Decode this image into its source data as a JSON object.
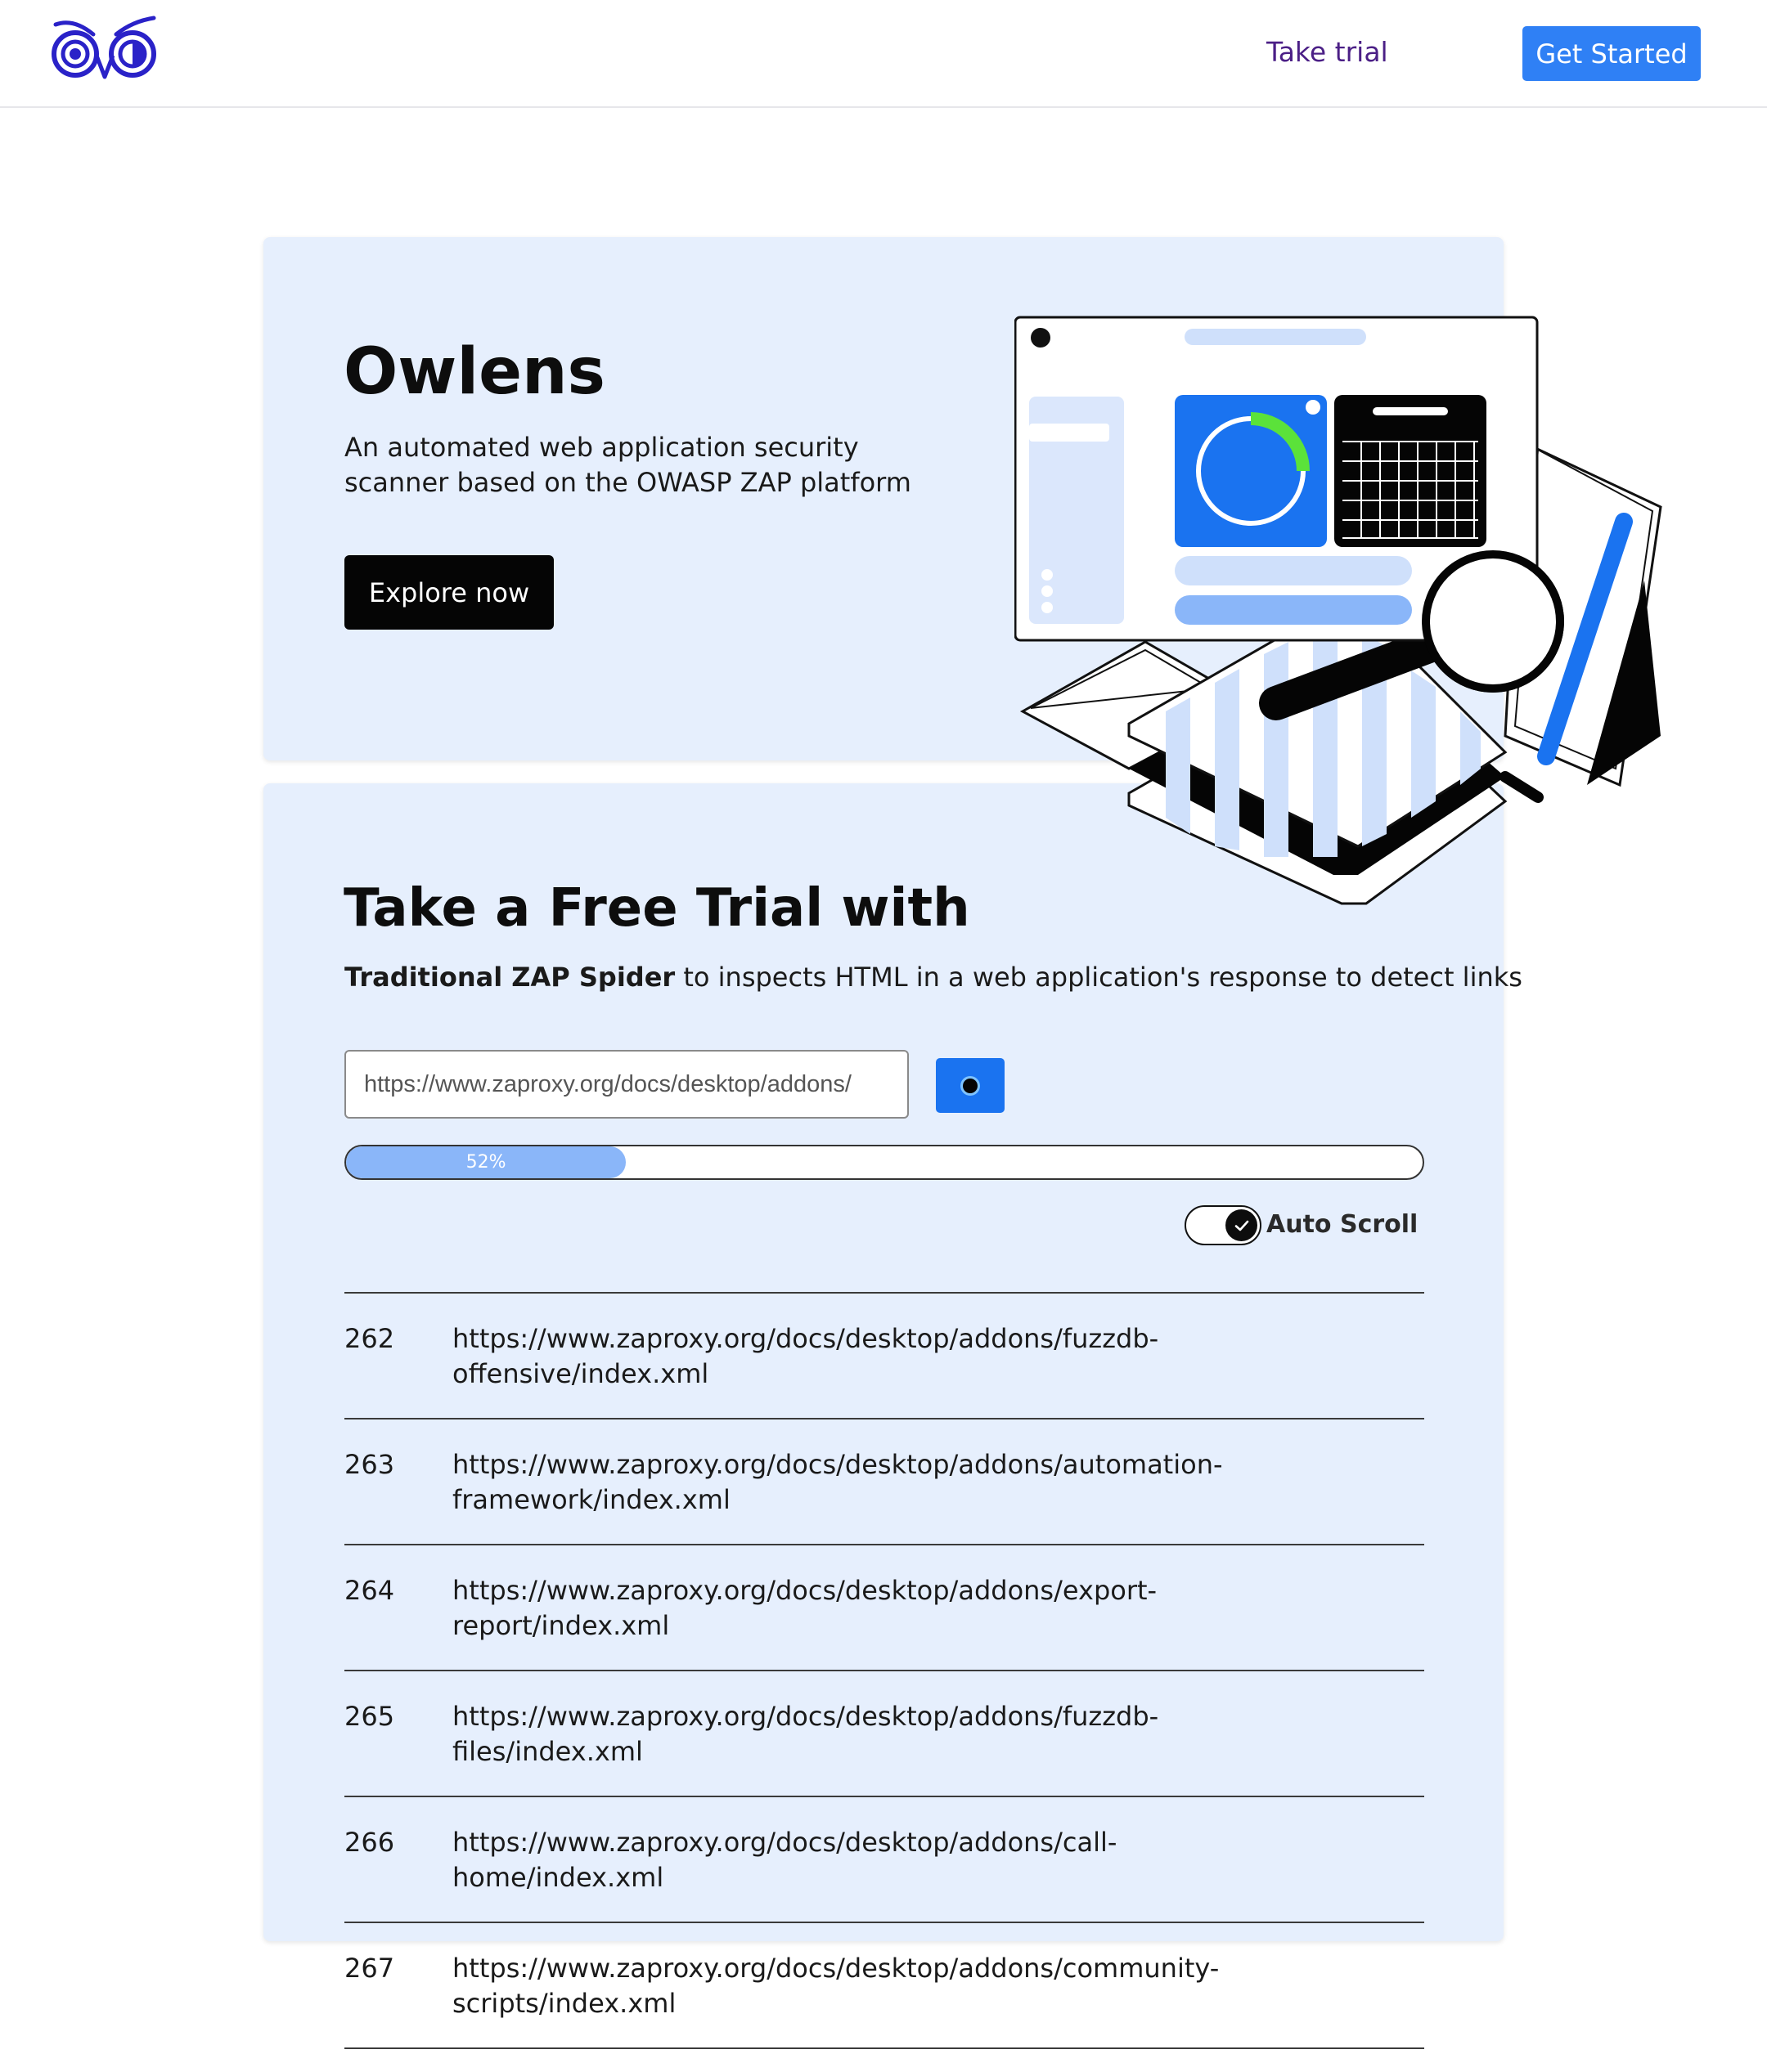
{
  "header": {
    "nav_trial": "Take trial",
    "get_started": "Get Started"
  },
  "hero": {
    "title": "Owlens",
    "description": "An automated web application security scanner based on the OWASP ZAP platform",
    "cta": "Explore now"
  },
  "trial": {
    "title": "Take a Free Trial with",
    "desc_bold": "Traditional ZAP Spider",
    "desc_rest": " to inspects HTML in a web application's response to detect links",
    "url_value": "https://www.zaproxy.org/docs/desktop/addons/",
    "progress": 52,
    "progress_label": "52%",
    "auto_scroll_label": "Auto Scroll",
    "auto_scroll_on": true
  },
  "results": [
    {
      "num": "262",
      "url": "https://www.zaproxy.org/docs/desktop/addons/fuzzdb-offensive/index.xml"
    },
    {
      "num": "263",
      "url": "https://www.zaproxy.org/docs/desktop/addons/automation-framework/index.xml"
    },
    {
      "num": "264",
      "url": "https://www.zaproxy.org/docs/desktop/addons/export-report/index.xml"
    },
    {
      "num": "265",
      "url": "https://www.zaproxy.org/docs/desktop/addons/fuzzdb-files/index.xml"
    },
    {
      "num": "266",
      "url": "https://www.zaproxy.org/docs/desktop/addons/call-home/index.xml"
    },
    {
      "num": "267",
      "url": "https://www.zaproxy.org/docs/desktop/addons/community-scripts/index.xml"
    }
  ],
  "icons": {
    "logo": "owl-logo-icon",
    "scan": "scan-eye-icon",
    "toggle": "check-icon"
  },
  "colors": {
    "brand_blue": "#2f80f5",
    "logo_indigo": "#2a22c8",
    "card_bg": "#e6effd",
    "progress_fill": "#8ab6f9",
    "nav_link": "#4b1f86"
  }
}
